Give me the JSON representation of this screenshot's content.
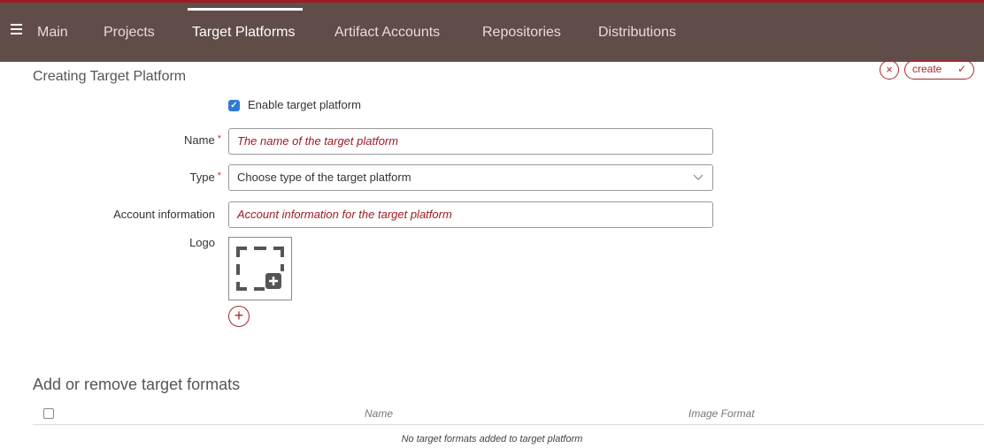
{
  "nav": {
    "items": [
      {
        "label": "Main"
      },
      {
        "label": "Projects"
      },
      {
        "label": "Target Platforms"
      },
      {
        "label": "Artifact Accounts"
      },
      {
        "label": "Repositories"
      },
      {
        "label": "Distributions"
      }
    ],
    "active_index": 2
  },
  "page": {
    "title": "Creating Target Platform",
    "cancel_icon": "×",
    "create_label": "create",
    "create_icon": "✓"
  },
  "form": {
    "enable_label": "Enable target platform",
    "enable_checked": true,
    "name_label": "Name",
    "name_placeholder": "The name of the target platform",
    "type_label": "Type",
    "type_value": "Choose type of the target platform",
    "account_label": "Account information",
    "account_placeholder": "Account information for the target platform",
    "logo_label": "Logo",
    "required_mark": "*",
    "add_logo_icon": "+"
  },
  "formats": {
    "section_title": "Add or remove target formats",
    "columns": [
      "Name",
      "Image Format"
    ],
    "empty_message": "No target formats added to target platform"
  },
  "colors": {
    "nav_bg": "#614d48",
    "nav_top_border": "#9d1c24",
    "accent": "#a42a2f",
    "checkbox": "#2f7ad6"
  }
}
